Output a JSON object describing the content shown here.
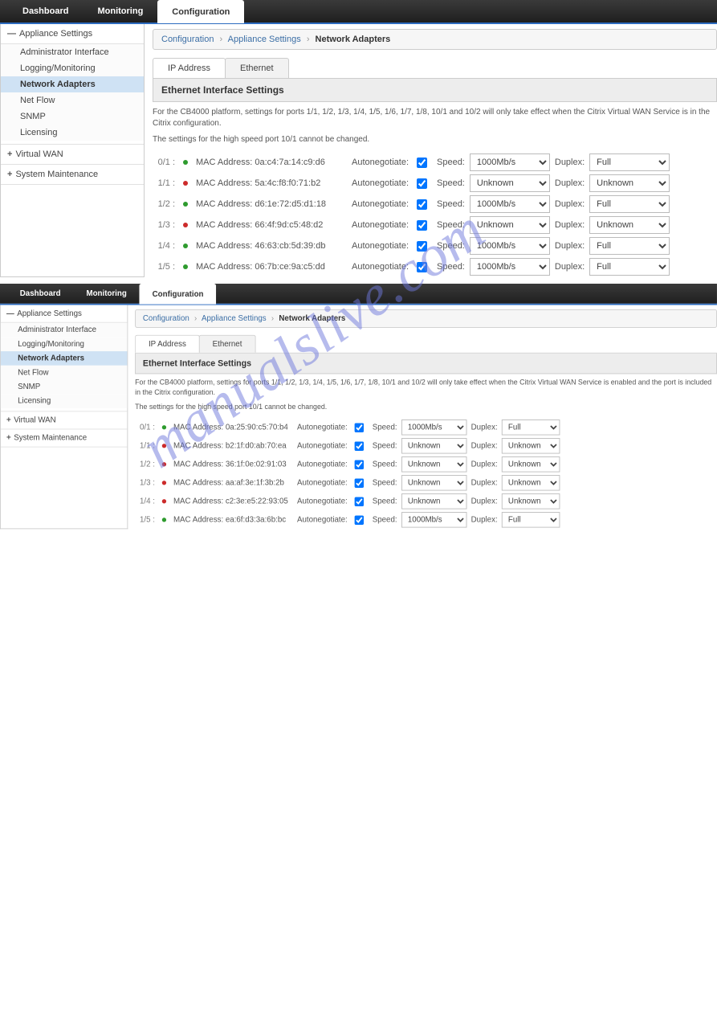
{
  "watermark": "manualslive.com",
  "nav": {
    "dashboard": "Dashboard",
    "monitoring": "Monitoring",
    "configuration": "Configuration"
  },
  "sidebar": {
    "appliance": "Appliance Settings",
    "items": [
      "Administrator Interface",
      "Logging/Monitoring",
      "Network Adapters",
      "Net Flow",
      "SNMP",
      "Licensing"
    ],
    "virtualwan": "Virtual WAN",
    "sysmaint": "System Maintenance",
    "minus": "—",
    "plus": "+"
  },
  "crumbs": {
    "c0": "Configuration",
    "c1": "Appliance Settings",
    "c2": "Network Adapters",
    "sep": "›"
  },
  "subtabs": {
    "ip": "IP Address",
    "eth": "Ethernet"
  },
  "panel": {
    "title": "Ethernet Interface Settings"
  },
  "labels": {
    "mac": "MAC Address:",
    "auto": "Autonegotiate:",
    "speed": "Speed:",
    "duplex": "Duplex:"
  },
  "opts": {
    "speed": [
      "1000Mb/s",
      "Unknown"
    ],
    "duplex": [
      "Full",
      "Unknown"
    ]
  },
  "block1": {
    "note1": "For the CB4000 platform, settings for ports 1/1, 1/2, 1/3, 1/4, 1/5, 1/6, 1/7, 1/8, 10/1 and 10/2 will only take effect when the Citrix Virtual WAN Service is in the Citrix configuration.",
    "note2": "The settings for the high speed port 10/1 cannot be changed.",
    "rows": [
      {
        "port": "0/1 :",
        "up": true,
        "mac": "0a:c4:7a:14:c9:d6",
        "speed": "1000Mb/s",
        "duplex": "Full"
      },
      {
        "port": "1/1 :",
        "up": false,
        "mac": "5a:4c:f8:f0:71:b2",
        "speed": "Unknown",
        "duplex": "Unknown"
      },
      {
        "port": "1/2 :",
        "up": true,
        "mac": "d6:1e:72:d5:d1:18",
        "speed": "1000Mb/s",
        "duplex": "Full"
      },
      {
        "port": "1/3 :",
        "up": false,
        "mac": "66:4f:9d:c5:48:d2",
        "speed": "Unknown",
        "duplex": "Unknown"
      },
      {
        "port": "1/4 :",
        "up": true,
        "mac": "46:63:cb:5d:39:db",
        "speed": "1000Mb/s",
        "duplex": "Full"
      },
      {
        "port": "1/5 :",
        "up": true,
        "mac": "06:7b:ce:9a:c5:dd",
        "speed": "1000Mb/s",
        "duplex": "Full"
      }
    ]
  },
  "block2": {
    "note1": "For the CB4000 platform, settings for ports 1/1, 1/2, 1/3, 1/4, 1/5, 1/6, 1/7, 1/8, 10/1 and 10/2 will only take effect when the Citrix Virtual WAN Service is enabled and the port is included in the Citrix configuration.",
    "note2": "The settings for the high speed port 10/1 cannot be changed.",
    "rows": [
      {
        "port": "0/1 :",
        "up": true,
        "mac": "0a:25:90:c5:70:b4",
        "speed": "1000Mb/s",
        "duplex": "Full"
      },
      {
        "port": "1/1 :",
        "up": false,
        "mac": "b2:1f:d0:ab:70:ea",
        "speed": "Unknown",
        "duplex": "Unknown"
      },
      {
        "port": "1/2 :",
        "up": false,
        "mac": "36:1f:0e:02:91:03",
        "speed": "Unknown",
        "duplex": "Unknown"
      },
      {
        "port": "1/3 :",
        "up": false,
        "mac": "aa:af:3e:1f:3b:2b",
        "speed": "Unknown",
        "duplex": "Unknown"
      },
      {
        "port": "1/4 :",
        "up": false,
        "mac": "c2:3e:e5:22:93:05",
        "speed": "Unknown",
        "duplex": "Unknown"
      },
      {
        "port": "1/5 :",
        "up": true,
        "mac": "ea:6f:d3:3a:6b:bc",
        "speed": "1000Mb/s",
        "duplex": "Full"
      }
    ]
  }
}
